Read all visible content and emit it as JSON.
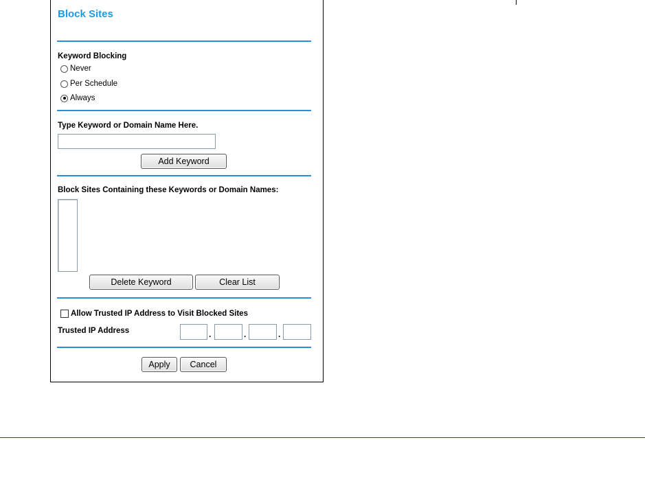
{
  "page": {
    "title": "Block Sites"
  },
  "keyword_blocking": {
    "label": "Keyword Blocking",
    "options": [
      "Never",
      "Per Schedule",
      "Always"
    ],
    "selected": "Always"
  },
  "keyword_entry": {
    "label": "Type Keyword or Domain Name Here.",
    "value": "",
    "add_button": "Add Keyword"
  },
  "blocked_list": {
    "label": "Block Sites Containing these Keywords or Domain Names:",
    "items": [],
    "delete_button": "Delete Keyword",
    "clear_button": "Clear List"
  },
  "trusted": {
    "checkbox_label": "Allow Trusted IP Address to Visit Blocked Sites",
    "checked": false,
    "ip_label": "Trusted IP Address",
    "ip_octets": [
      "",
      "",
      "",
      ""
    ]
  },
  "actions": {
    "apply": "Apply",
    "cancel": "Cancel"
  },
  "colors": {
    "title": "#1a9be3",
    "divider": "#2a8fd6",
    "footer_rule": "#2b3d7a"
  }
}
